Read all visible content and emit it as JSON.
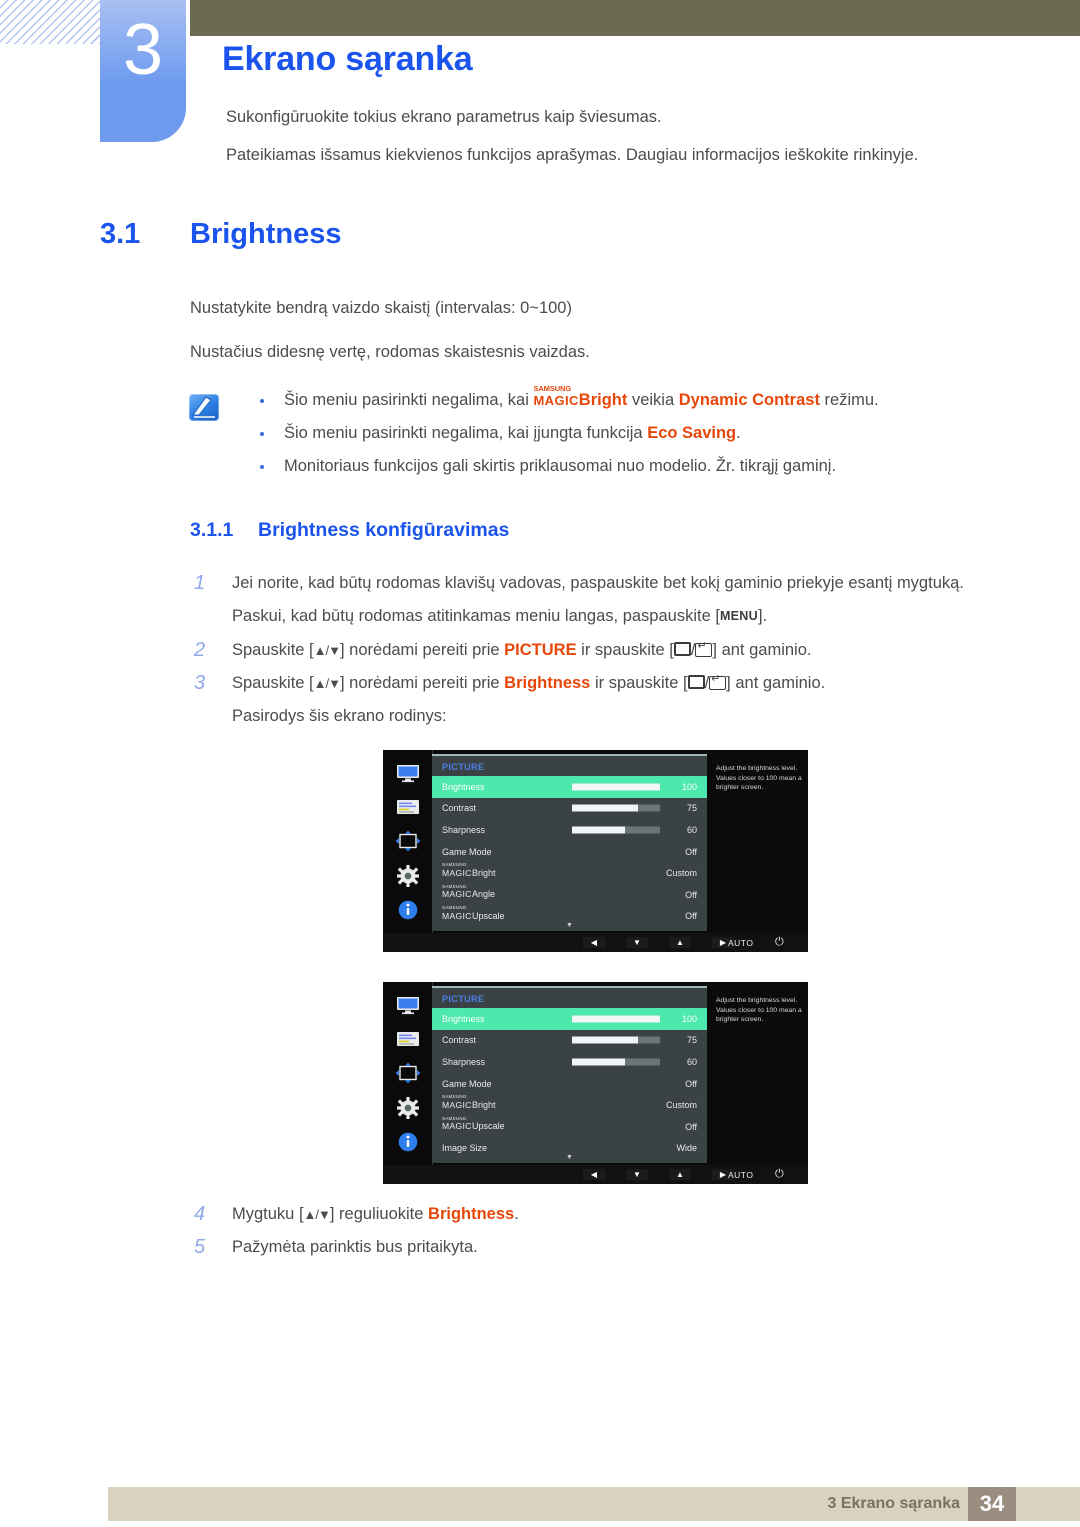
{
  "chapter": {
    "number": "3",
    "title": "Ekrano sąranka",
    "intro_line1": "Sukonfigūruokite tokius ekrano parametrus kaip šviesumas.",
    "intro_line2": "Pateikiamas išsamus kiekvienos funkcijos aprašymas. Daugiau informacijos ieškokite rinkinyje."
  },
  "section": {
    "number": "3.1",
    "title": "Brightness",
    "para1": "Nustatykite bendrą vaizdo skaistį (intervalas: 0~100)",
    "para2": "Nustačius didesnę vertę, rodomas skaistesnis vaizdas."
  },
  "note": {
    "icon": "note-pen-icon",
    "bullets": [
      {
        "pre": "Šio meniu pasirinkti negalima, kai ",
        "magic_top": "SAMSUNG",
        "magic_bottom": "MAGIC",
        "magic_suffix": "Bright",
        "mid": " veikia ",
        "highlight": "Dynamic Contrast",
        "post": " režimu."
      },
      {
        "pre": "Šio meniu pasirinkti negalima, kai įjungta funkcija ",
        "highlight": "Eco Saving",
        "post": "."
      },
      {
        "pre": "Monitoriaus funkcijos gali skirtis priklausomai nuo modelio. Žr. tikrąjį gaminį.",
        "highlight": "",
        "post": ""
      }
    ]
  },
  "subsection": {
    "number": "3.1.1",
    "title": "Brightness konfigūravimas"
  },
  "steps": [
    {
      "num": "1",
      "text_a": "Jei norite, kad būtų rodomas klavišų vadovas, paspauskite bet kokį gaminio priekyje esantį mygtuką.",
      "cont_a": "Paskui, kad būtų rodomas atitinkamas meniu langas, paspauskite [",
      "cont_key": "MENU",
      "cont_b": "]."
    },
    {
      "num": "2",
      "pre": "Spauskite [",
      "arrows": "▲/▼",
      "mid": "] norėdami pereiti prie ",
      "highlight": "PICTURE",
      "mid2": " ir spauskite [",
      "mid3": "/",
      "post": "] ant gaminio."
    },
    {
      "num": "3",
      "pre": "Spauskite [",
      "arrows": "▲/▼",
      "mid": "] norėdami pereiti prie ",
      "highlight": "Brightness",
      "mid2": " ir spauskite [",
      "mid3": "/",
      "post": "] ant gaminio.",
      "cont": "Pasirodys šis ekrano rodinys:"
    }
  ],
  "steps_after": [
    {
      "num": "4",
      "pre": "Mygtuku [",
      "arrows": "▲/▼",
      "mid": "] reguliuokite ",
      "highlight": "Brightness",
      "post": "."
    },
    {
      "num": "5",
      "pre": "Pažymėta parinktis bus pritaikyta.",
      "highlight": "",
      "post": ""
    }
  ],
  "osd": {
    "title": "PICTURE",
    "description": "Adjust the brightness level. Values closer to 100 mean a brighter screen.",
    "sidebar_icons": [
      "monitor-icon",
      "onscreen-display-icon",
      "position-adjust-icon",
      "gear-icon",
      "information-icon"
    ],
    "scroll_indicator": "▼",
    "controls": {
      "left": "◀",
      "down": "▼",
      "up": "▲",
      "right": "▶",
      "auto": "AUTO",
      "power": "⏻"
    },
    "menu1_rows": [
      {
        "label": "Brightness",
        "value": "100",
        "bar": 100,
        "selected": true,
        "magic": false
      },
      {
        "label": "Contrast",
        "value": "75",
        "bar": 75,
        "selected": false,
        "magic": false
      },
      {
        "label": "Sharpness",
        "value": "60",
        "bar": 60,
        "selected": false,
        "magic": false
      },
      {
        "label": "Game Mode",
        "value": "Off",
        "bar": null,
        "selected": false,
        "magic": false
      },
      {
        "label": "Bright",
        "value": "Custom",
        "bar": null,
        "selected": false,
        "magic": true
      },
      {
        "label": "Angle",
        "value": "Off",
        "bar": null,
        "selected": false,
        "magic": true
      },
      {
        "label": "Upscale",
        "value": "Off",
        "bar": null,
        "selected": false,
        "magic": true
      }
    ],
    "menu2_rows": [
      {
        "label": "Brightness",
        "value": "100",
        "bar": 100,
        "selected": true,
        "magic": false
      },
      {
        "label": "Contrast",
        "value": "75",
        "bar": 75,
        "selected": false,
        "magic": false
      },
      {
        "label": "Sharpness",
        "value": "60",
        "bar": 60,
        "selected": false,
        "magic": false
      },
      {
        "label": "Game Mode",
        "value": "Off",
        "bar": null,
        "selected": false,
        "magic": false
      },
      {
        "label": "Bright",
        "value": "Custom",
        "bar": null,
        "selected": false,
        "magic": true
      },
      {
        "label": "Upscale",
        "value": "Off",
        "bar": null,
        "selected": false,
        "magic": true
      },
      {
        "label": "Image Size",
        "value": "Wide",
        "bar": null,
        "selected": false,
        "magic": false
      }
    ],
    "magic_top": "SAMSUNG",
    "magic_bottom": "MAGIC"
  },
  "footer": {
    "text": "3 Ekrano sąranka",
    "page": "34"
  },
  "colors": {
    "accent_blue": "#1a54ec",
    "tab_blue": "#6f9bef",
    "highlight_red": "#e8470a",
    "olive": "#6c6a51",
    "footer_bar": "#d8d2bf",
    "footer_num": "#9a8d80",
    "osd_selected_green": "#4de8ad"
  }
}
